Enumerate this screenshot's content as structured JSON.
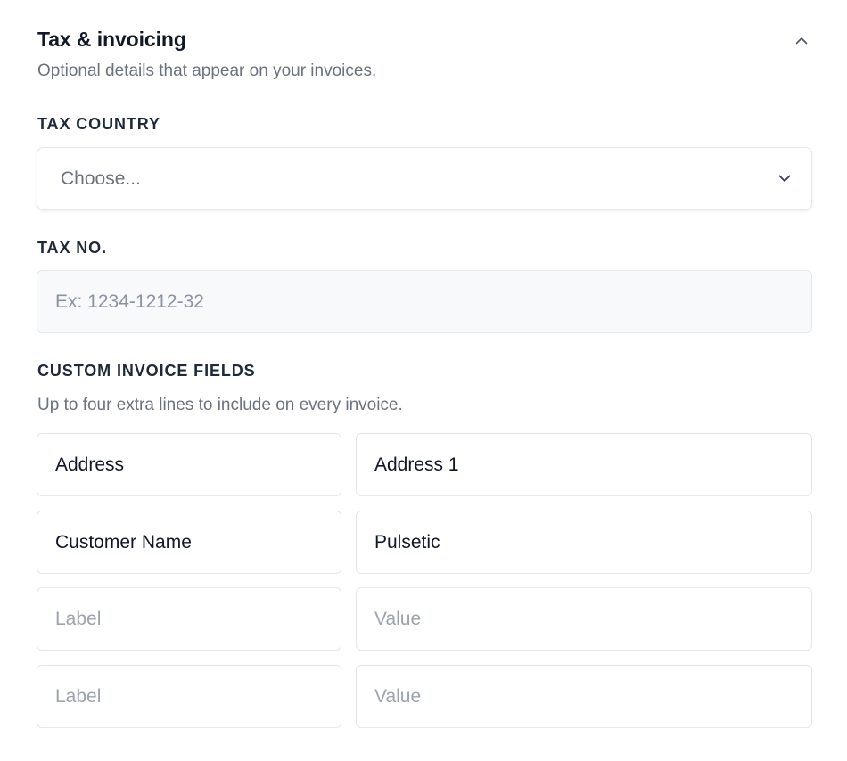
{
  "section": {
    "title": "Tax & invoicing",
    "subtitle": "Optional details that appear on your invoices.",
    "collapse_icon": "chevron-up-icon"
  },
  "tax_country": {
    "label": "TAX COUNTRY",
    "selected": "Choose...",
    "chevron_icon": "chevron-down-icon"
  },
  "tax_no": {
    "label": "TAX NO.",
    "value": "",
    "placeholder": "Ex: 1234-1212-32"
  },
  "custom_fields": {
    "label": "CUSTOM INVOICE FIELDS",
    "helper": "Up to four extra lines to include on every invoice.",
    "rows": [
      {
        "label": "Address",
        "label_placeholder": "Label",
        "value": "Address 1",
        "value_placeholder": "Value"
      },
      {
        "label": "Customer Name",
        "label_placeholder": "Label",
        "value": "Pulsetic",
        "value_placeholder": "Value"
      },
      {
        "label": "",
        "label_placeholder": "Label",
        "value": "",
        "value_placeholder": "Value"
      },
      {
        "label": "",
        "label_placeholder": "Label",
        "value": "",
        "value_placeholder": "Value"
      }
    ]
  },
  "colors": {
    "text": "#111827",
    "muted": "#6b7280",
    "placeholder": "#9ca3af",
    "border": "#e5e7eb",
    "input_bg_disabled": "#f8f9fb"
  }
}
